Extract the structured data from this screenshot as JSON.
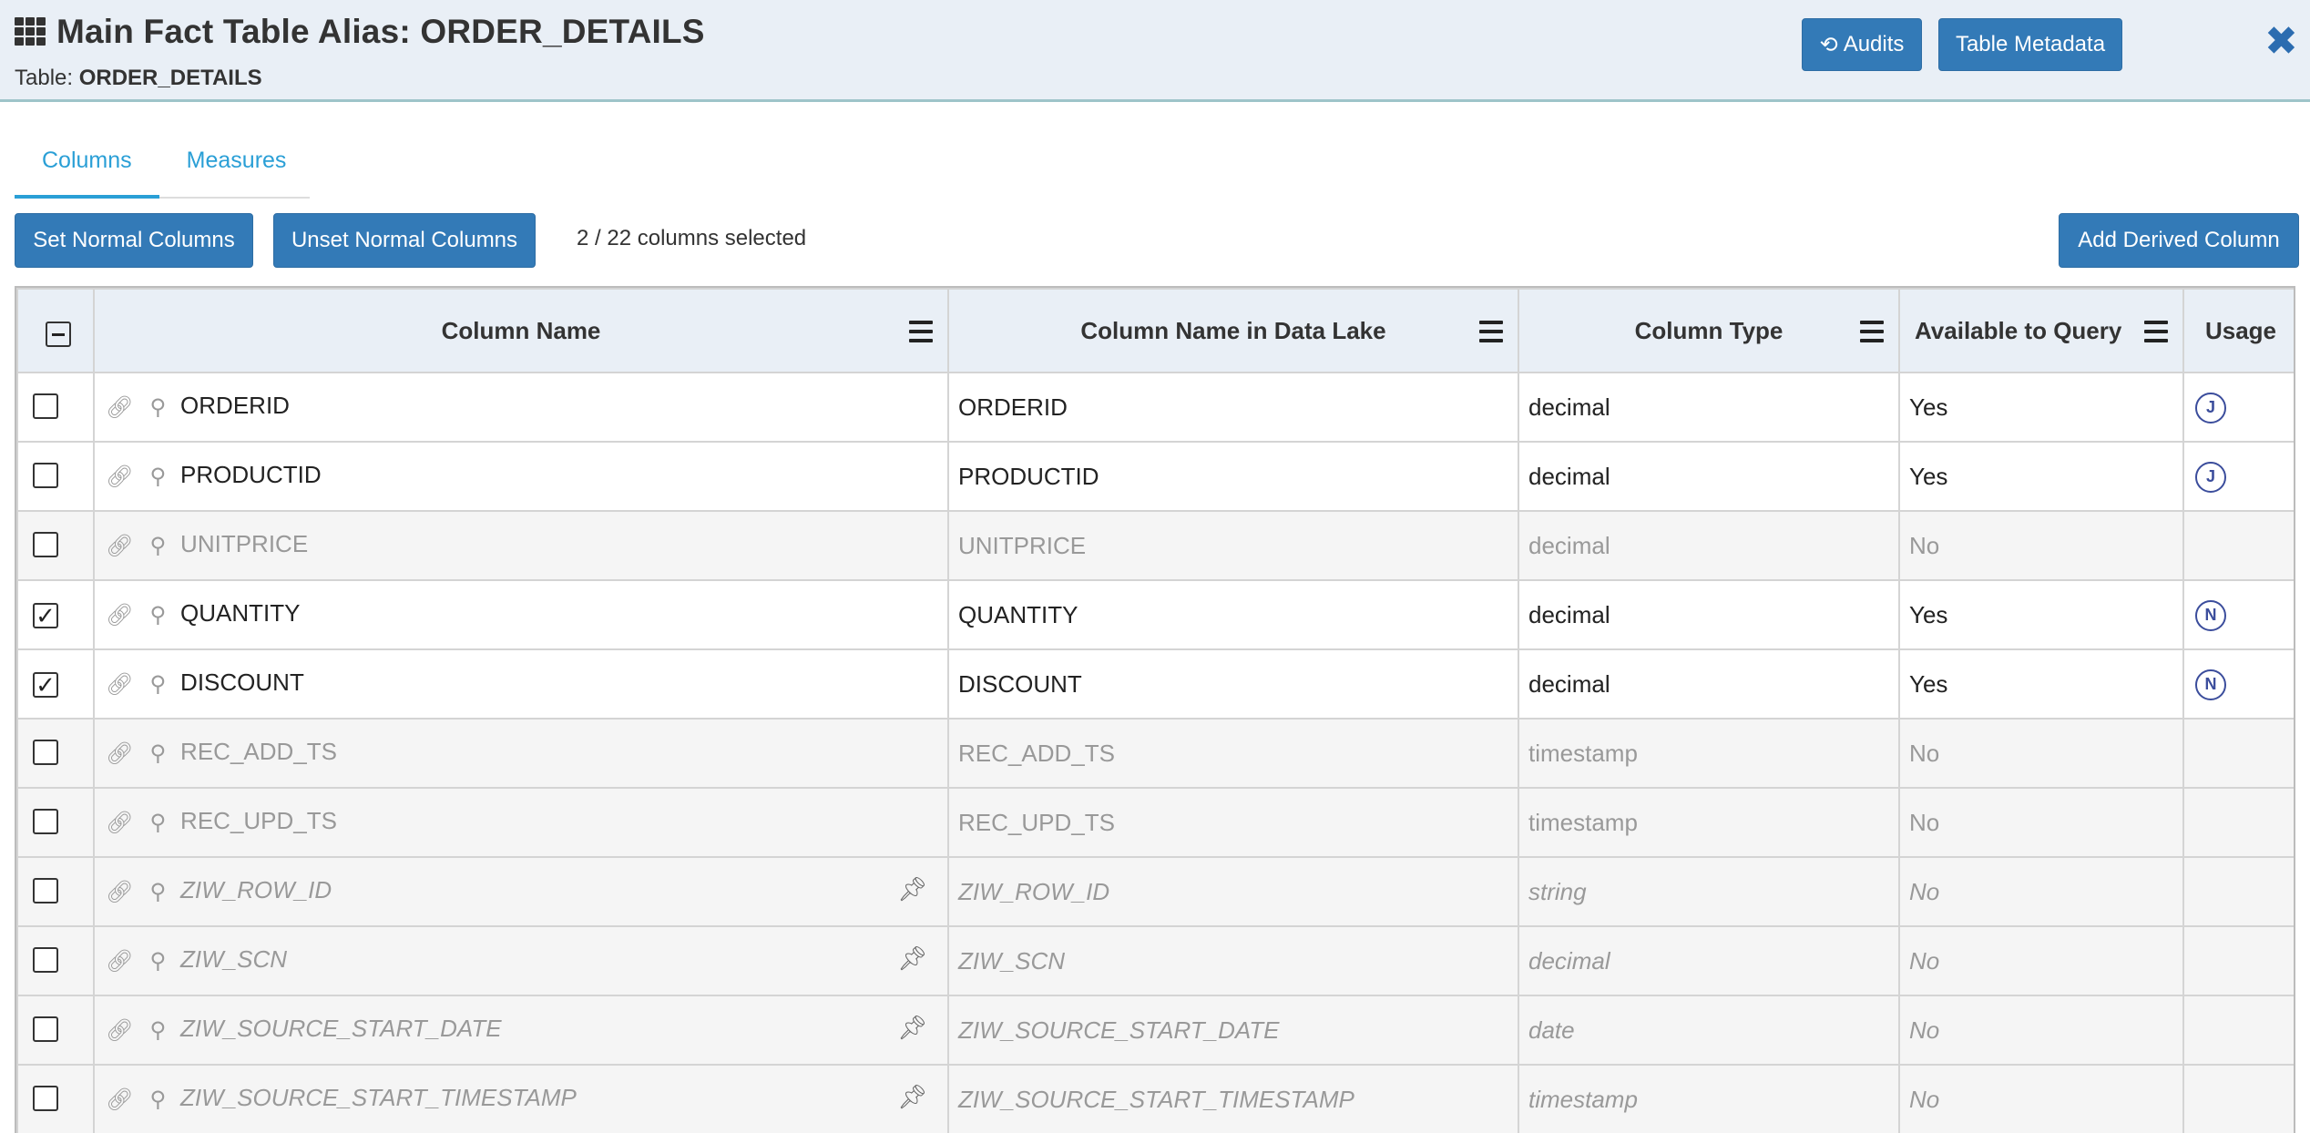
{
  "header": {
    "title": "Main Fact Table Alias: ORDER_DETAILS",
    "table_label": "Table:",
    "table_name": "ORDER_DETAILS",
    "audits_label": "Audits",
    "metadata_label": "Table Metadata",
    "close_glyph": "✖"
  },
  "tabs": [
    {
      "label": "Columns",
      "active": true
    },
    {
      "label": "Measures",
      "active": false
    }
  ],
  "toolbar": {
    "set_normal_label": "Set Normal Columns",
    "unset_normal_label": "Unset Normal Columns",
    "selection_text": "2 / 22 columns selected",
    "add_derived_label": "Add Derived Column"
  },
  "table": {
    "headers": {
      "name": "Column Name",
      "lake": "Column Name in Data Lake",
      "type": "Column Type",
      "avail": "Available to Query",
      "usage": "Usage"
    },
    "rows": [
      {
        "name": "ORDERID",
        "lake": "ORDERID",
        "type": "decimal",
        "avail": "Yes",
        "usage": "J",
        "checked": false,
        "dim": false,
        "italic": false,
        "pinned": false
      },
      {
        "name": "PRODUCTID",
        "lake": "PRODUCTID",
        "type": "decimal",
        "avail": "Yes",
        "usage": "J",
        "checked": false,
        "dim": false,
        "italic": false,
        "pinned": false
      },
      {
        "name": "UNITPRICE",
        "lake": "UNITPRICE",
        "type": "decimal",
        "avail": "No",
        "usage": "",
        "checked": false,
        "dim": true,
        "italic": false,
        "pinned": false
      },
      {
        "name": "QUANTITY",
        "lake": "QUANTITY",
        "type": "decimal",
        "avail": "Yes",
        "usage": "N",
        "checked": true,
        "dim": false,
        "italic": false,
        "pinned": false
      },
      {
        "name": "DISCOUNT",
        "lake": "DISCOUNT",
        "type": "decimal",
        "avail": "Yes",
        "usage": "N",
        "checked": true,
        "dim": false,
        "italic": false,
        "pinned": false
      },
      {
        "name": "REC_ADD_TS",
        "lake": "REC_ADD_TS",
        "type": "timestamp",
        "avail": "No",
        "usage": "",
        "checked": false,
        "dim": true,
        "italic": false,
        "pinned": false
      },
      {
        "name": "REC_UPD_TS",
        "lake": "REC_UPD_TS",
        "type": "timestamp",
        "avail": "No",
        "usage": "",
        "checked": false,
        "dim": true,
        "italic": false,
        "pinned": false
      },
      {
        "name": "ZIW_ROW_ID",
        "lake": "ZIW_ROW_ID",
        "type": "string",
        "avail": "No",
        "usage": "",
        "checked": false,
        "dim": true,
        "italic": true,
        "pinned": true
      },
      {
        "name": "ZIW_SCN",
        "lake": "ZIW_SCN",
        "type": "decimal",
        "avail": "No",
        "usage": "",
        "checked": false,
        "dim": true,
        "italic": true,
        "pinned": true
      },
      {
        "name": "ZIW_SOURCE_START_DATE",
        "lake": "ZIW_SOURCE_START_DATE",
        "type": "date",
        "avail": "No",
        "usage": "",
        "checked": false,
        "dim": true,
        "italic": true,
        "pinned": true
      },
      {
        "name": "ZIW_SOURCE_START_TIMESTAMP",
        "lake": "ZIW_SOURCE_START_TIMESTAMP",
        "type": "timestamp",
        "avail": "No",
        "usage": "",
        "checked": false,
        "dim": true,
        "italic": true,
        "pinned": true
      }
    ]
  }
}
